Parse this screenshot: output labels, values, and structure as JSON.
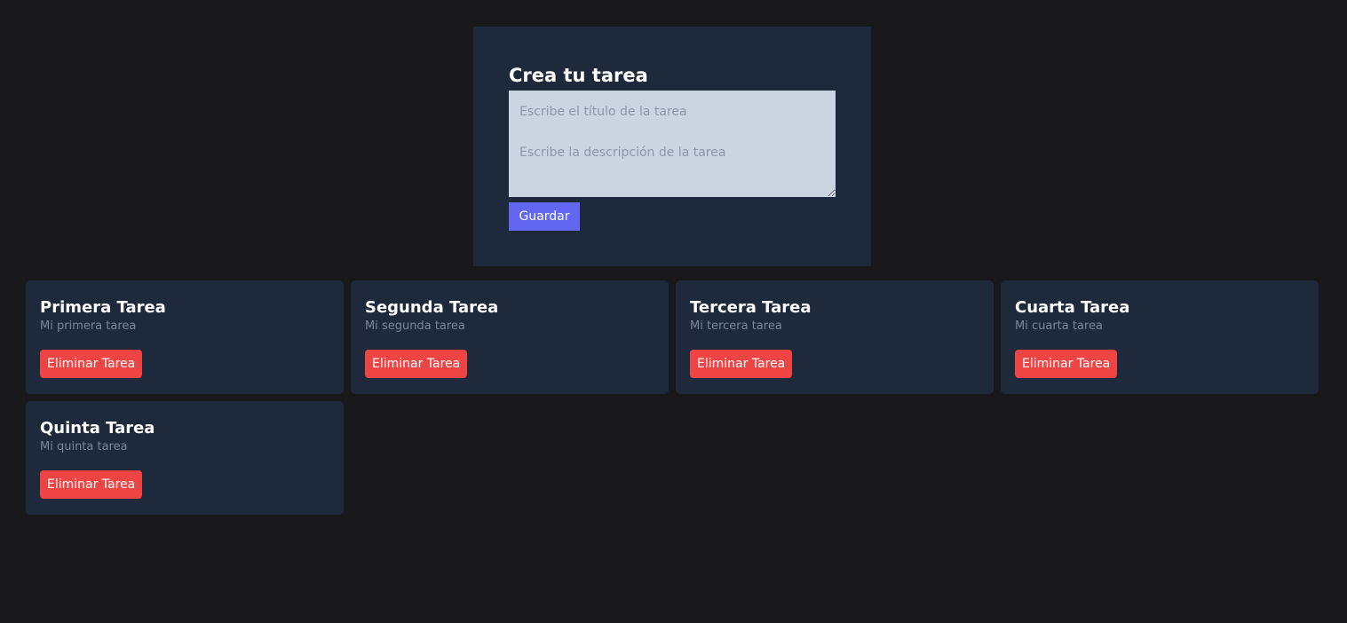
{
  "form": {
    "heading": "Crea tu tarea",
    "title_placeholder": "Escribe el título de la tarea",
    "description_placeholder": "Escribe la descripción de la tarea",
    "save_label": "Guardar"
  },
  "tasks": [
    {
      "title": "Primera Tarea",
      "description": "Mi primera tarea",
      "delete_label": "Eliminar Tarea"
    },
    {
      "title": "Segunda Tarea",
      "description": "Mi segunda tarea",
      "delete_label": "Eliminar Tarea"
    },
    {
      "title": "Tercera Tarea",
      "description": "Mi tercera tarea",
      "delete_label": "Eliminar Tarea"
    },
    {
      "title": "Cuarta Tarea",
      "description": "Mi cuarta tarea",
      "delete_label": "Eliminar Tarea"
    },
    {
      "title": "Quinta Tarea",
      "description": "Mi quinta tarea",
      "delete_label": "Eliminar Tarea"
    }
  ],
  "colors": {
    "page_background": "#18181b",
    "panel_background": "#1e293b",
    "input_background": "#cbd5e1",
    "save_button": "#6366f1",
    "delete_button": "#ef4444"
  }
}
